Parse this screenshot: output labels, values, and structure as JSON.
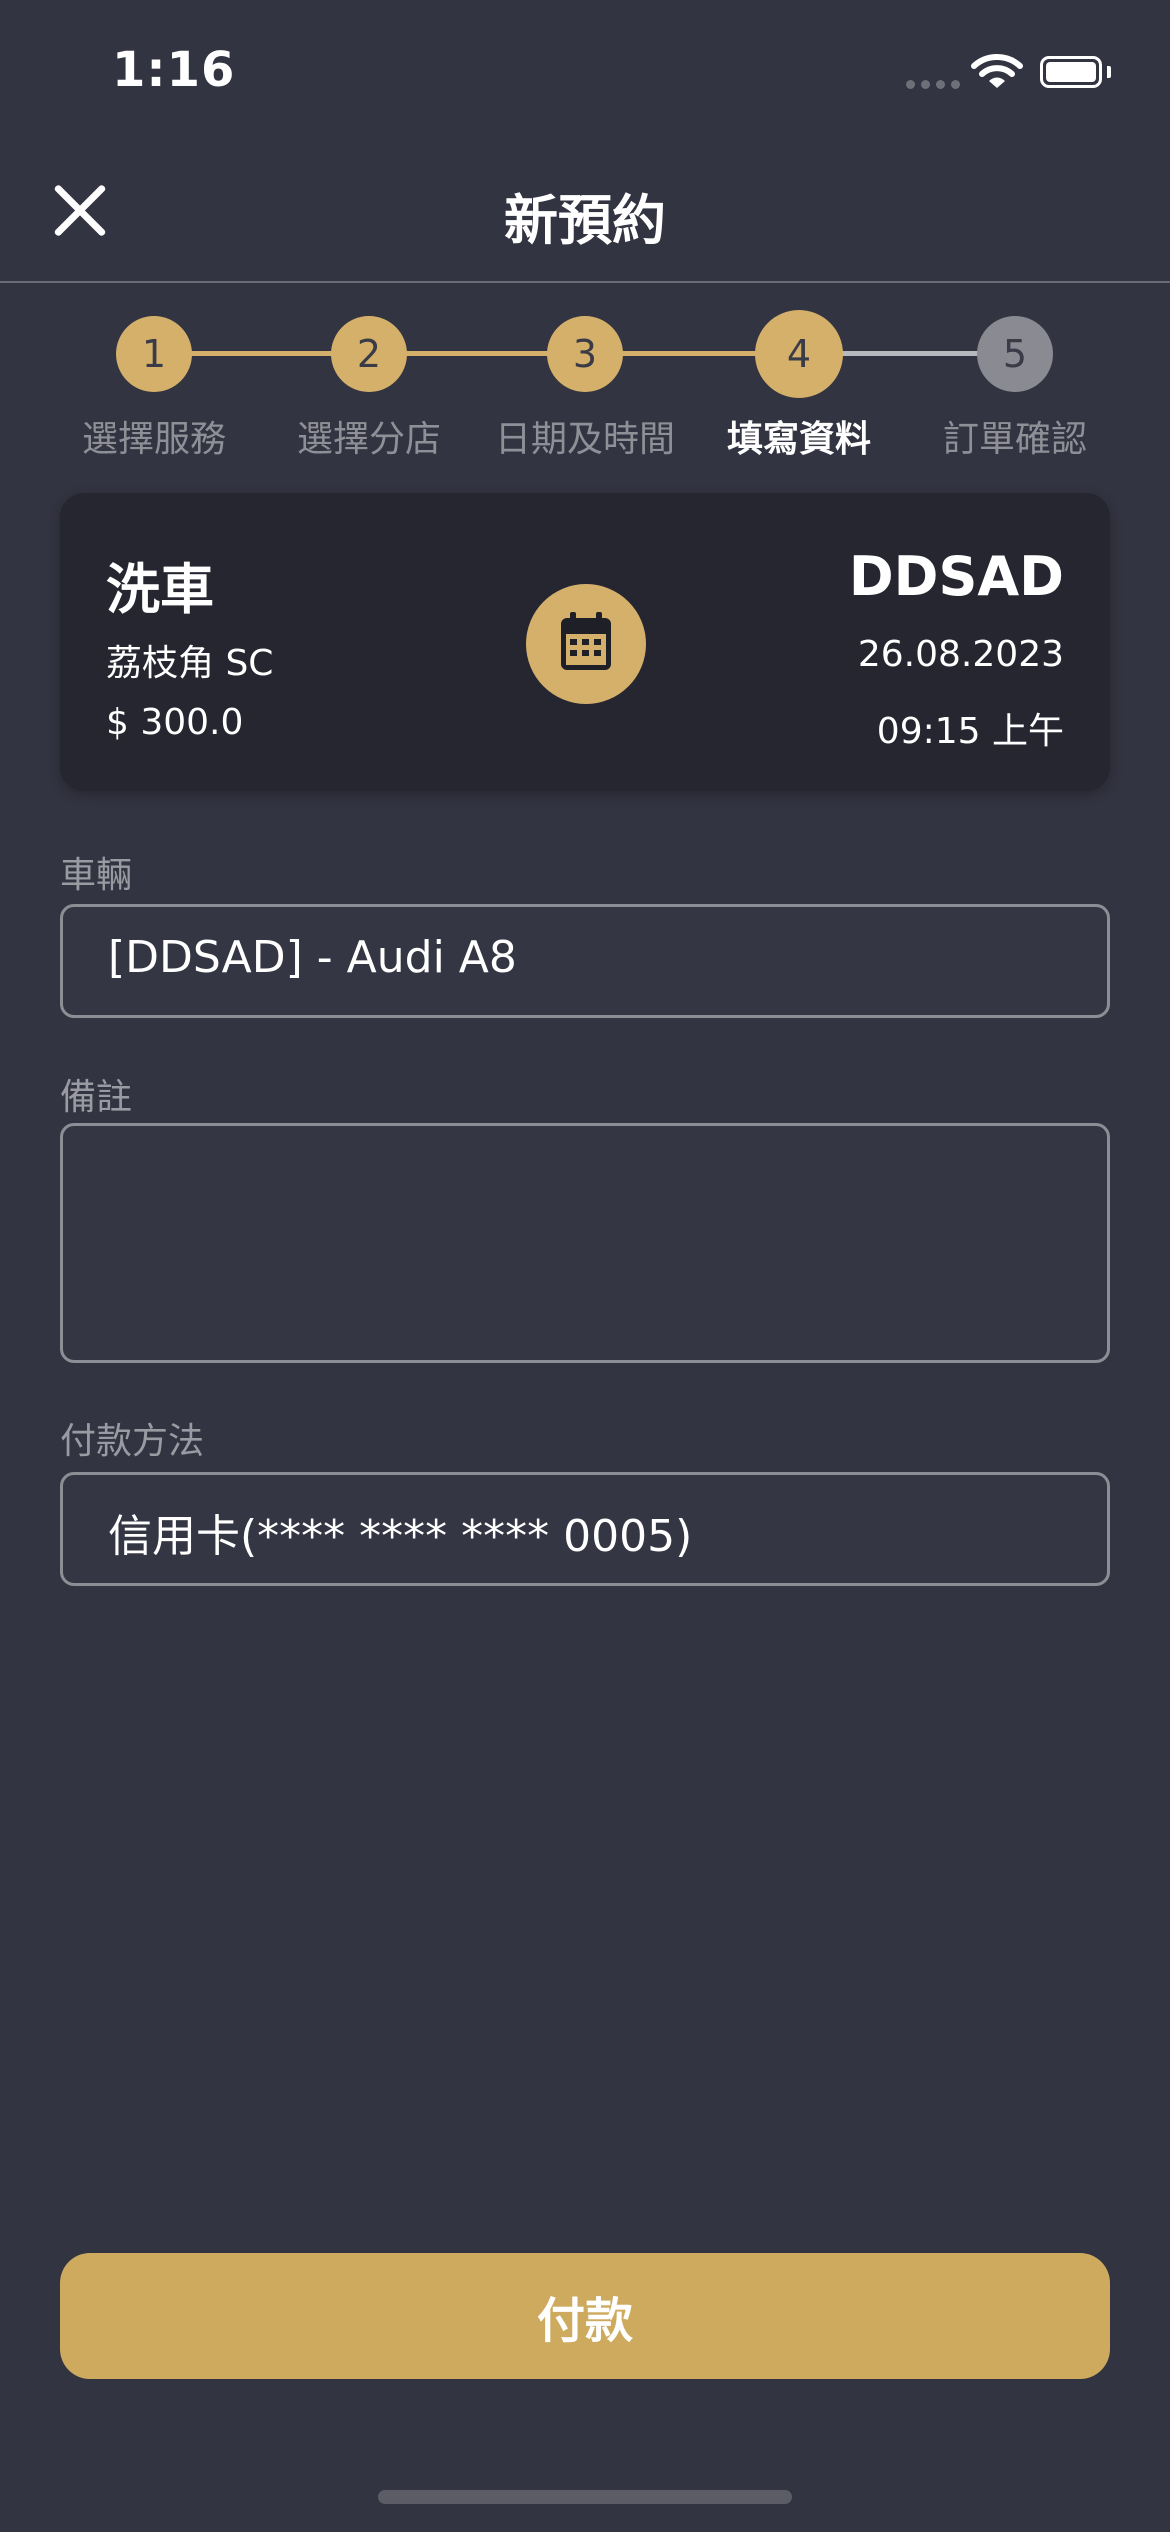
{
  "status_bar": {
    "time": "1:16"
  },
  "header": {
    "title": "新預約"
  },
  "steps": [
    {
      "number": "1",
      "label": "選擇服務",
      "state": "done"
    },
    {
      "number": "2",
      "label": "選擇分店",
      "state": "done"
    },
    {
      "number": "3",
      "label": "日期及時間",
      "state": "done"
    },
    {
      "number": "4",
      "label": "填寫資料",
      "state": "active"
    },
    {
      "number": "5",
      "label": "訂單確認",
      "state": "todo"
    }
  ],
  "summary": {
    "service": "洗車",
    "branch": "荔枝角 SC",
    "price": "$ 300.0",
    "plate": "DDSAD",
    "date": "26.08.2023",
    "time": "09:15 上午",
    "icon": "calendar-icon"
  },
  "form": {
    "vehicle_label": "車輛",
    "vehicle_value": "[DDSAD] - Audi A8",
    "remarks_label": "備註",
    "remarks_value": "",
    "payment_label": "付款方法",
    "payment_value": "信用卡(**** **** **** 0005)"
  },
  "actions": {
    "pay_label": "付款"
  },
  "colors": {
    "background": "#333441",
    "accent": "#d4b06a",
    "card": "#262631",
    "pending": "#8a8a92"
  }
}
